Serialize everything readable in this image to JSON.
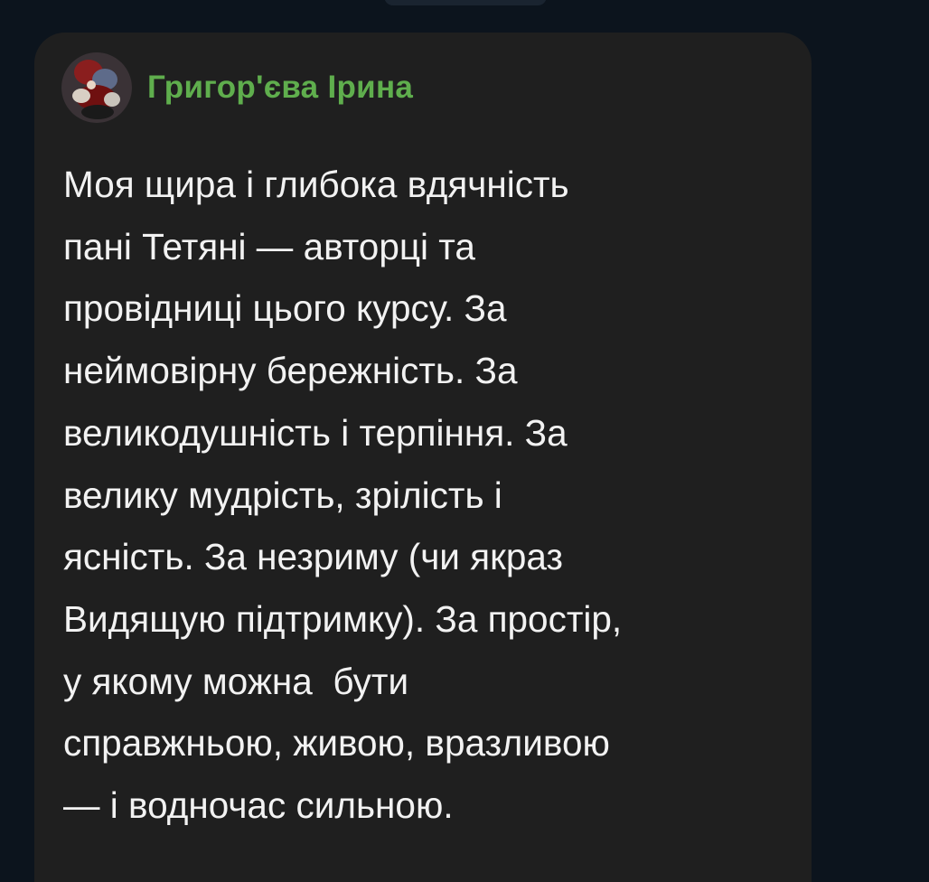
{
  "sender": {
    "name": "Григор'єва Ірина",
    "avatar": "avatar-image",
    "name_color": "#5fae4d"
  },
  "message": {
    "lines": [
      "Моя щира і глибока вдячність",
      "пані Тетяні — авторці та",
      "провідниці цього курсу. За",
      "неймовірну бережність. За",
      "великодушність і терпіння. За",
      "велику мудрість, зрілість і",
      "ясність. За незриму (чи якраз",
      "Видящую підтримку). За простір,",
      "у якому можна  бути",
      "справжньою, живою, вразливою",
      "— і водночас сильною."
    ]
  },
  "colors": {
    "background": "#0c141d",
    "bubble": "#1f1f1f",
    "text": "#f2f2f2"
  }
}
